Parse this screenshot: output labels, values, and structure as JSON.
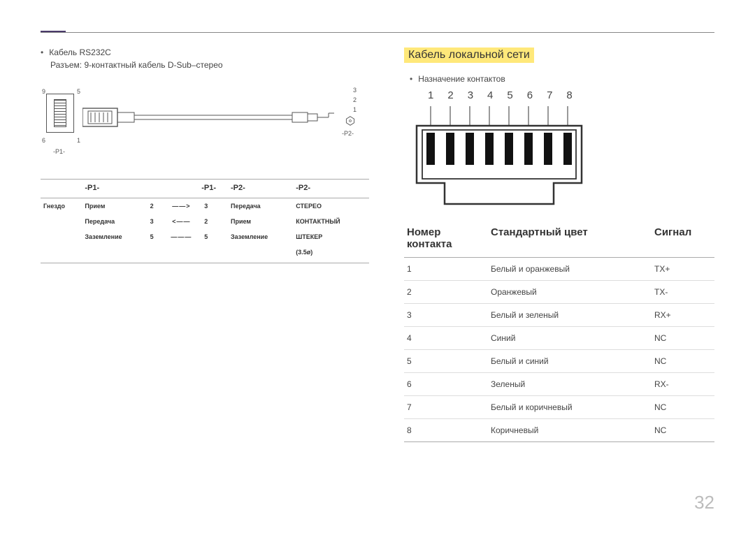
{
  "page_number": "32",
  "left": {
    "cable_title": "Кабель RS232C",
    "connector_desc": "Разъем: 9-контактный кабель D-Sub–стерео",
    "pin_labels": {
      "top_left": "9",
      "top_right": "5",
      "bottom_left": "6",
      "bottom_right": "1",
      "p1": "-P1-",
      "p2": "-P2-",
      "r1": "3",
      "r2": "2",
      "r3": "1"
    },
    "headers": [
      "-P1-",
      "-P1-",
      "-P2-",
      "-P2-"
    ],
    "rows": [
      {
        "c0": "Гнездо",
        "c1": "Прием",
        "c2": "2",
        "arrow": "——>",
        "c3": "3",
        "c4": "Передача",
        "c5": "СТЕРЕО"
      },
      {
        "c0": "",
        "c1": "Передача",
        "c2": "3",
        "arrow": "<——",
        "c3": "2",
        "c4": "Прием",
        "c5": "КОНТАКТНЫЙ"
      },
      {
        "c0": "",
        "c1": "Заземление",
        "c2": "5",
        "arrow": "———",
        "c3": "5",
        "c4": "Заземление",
        "c5": "ШТЕКЕР"
      }
    ],
    "extra": "(3.5ø)"
  },
  "right": {
    "section_title": "Кабель локальной сети",
    "assignment": "Назначение контактов",
    "pin_numbers": [
      "1",
      "2",
      "3",
      "4",
      "5",
      "6",
      "7",
      "8"
    ],
    "headers": {
      "pin": "Номер контакта",
      "color": "Стандартный цвет",
      "signal": "Сигнал"
    },
    "rows": [
      {
        "pin": "1",
        "color": "Белый и оранжевый",
        "signal": "TX+"
      },
      {
        "pin": "2",
        "color": "Оранжевый",
        "signal": "TX-"
      },
      {
        "pin": "3",
        "color": "Белый и зеленый",
        "signal": "RX+"
      },
      {
        "pin": "4",
        "color": "Синий",
        "signal": "NC"
      },
      {
        "pin": "5",
        "color": "Белый и синий",
        "signal": "NC"
      },
      {
        "pin": "6",
        "color": "Зеленый",
        "signal": "RX-"
      },
      {
        "pin": "7",
        "color": "Белый и коричневый",
        "signal": "NC"
      },
      {
        "pin": "8",
        "color": "Коричневый",
        "signal": "NC"
      }
    ]
  }
}
